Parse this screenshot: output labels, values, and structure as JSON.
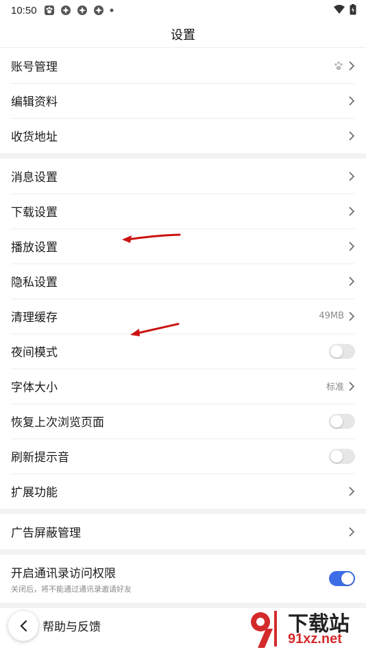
{
  "status_bar": {
    "time": "10:50"
  },
  "title": "设置",
  "groups": [
    [
      {
        "label": "账号管理",
        "type": "chevron",
        "icon": "paw-icon"
      },
      {
        "label": "编辑资料",
        "type": "chevron"
      },
      {
        "label": "收货地址",
        "type": "chevron"
      }
    ],
    [
      {
        "label": "消息设置",
        "type": "chevron"
      },
      {
        "label": "下载设置",
        "type": "chevron"
      },
      {
        "label": "播放设置",
        "type": "chevron"
      },
      {
        "label": "隐私设置",
        "type": "chevron"
      },
      {
        "label": "清理缓存",
        "type": "chevron",
        "value": "49MB"
      },
      {
        "label": "夜间模式",
        "type": "toggle",
        "on": false
      },
      {
        "label": "字体大小",
        "type": "chevron",
        "value": "标准"
      },
      {
        "label": "恢复上次浏览页面",
        "type": "toggle",
        "on": false
      },
      {
        "label": "刷新提示音",
        "type": "toggle",
        "on": false
      },
      {
        "label": "扩展功能",
        "type": "chevron"
      }
    ],
    [
      {
        "label": "广告屏蔽管理",
        "type": "chevron"
      }
    ],
    [
      {
        "label": "开启通讯录访问权限",
        "type": "toggle",
        "on": true,
        "sub": "关闭后，将不能通过通讯录邀请好友"
      }
    ],
    [
      {
        "label": "帮助与反馈",
        "type": "chevron"
      }
    ]
  ],
  "watermark": {
    "brand": "下载站",
    "domain": "91xz.net"
  },
  "colors": {
    "toggle_on": "#3d6ee8",
    "annotation": "#cc1111"
  }
}
